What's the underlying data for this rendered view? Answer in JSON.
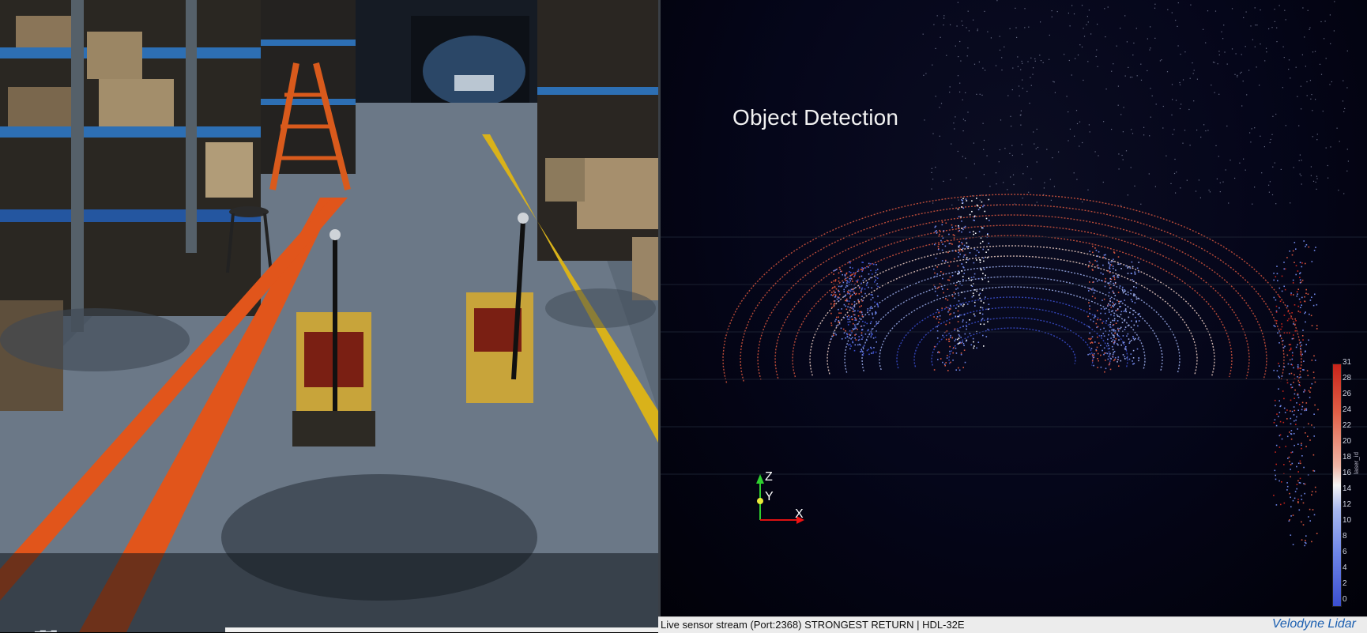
{
  "lidar_viewer": {
    "overlay_title": "Object Detection",
    "axes": {
      "z_label": "Z",
      "y_label": "Y",
      "x_label": "X"
    },
    "colorbar": {
      "field_label": "laser_id",
      "ticks": [
        "31",
        "28",
        "26",
        "24",
        "22",
        "20",
        "18",
        "16",
        "14",
        "12",
        "10",
        "8",
        "6",
        "4",
        "2",
        "0"
      ],
      "min": 0,
      "max": 31,
      "colors": {
        "high": "#c8231a",
        "mid": "#f5f5f5",
        "low": "#3b4fd0"
      }
    },
    "status_bar": {
      "stream_text": "Live sensor stream (Port:2368) STRONGEST RETURN  |  HDL-32E",
      "brand": "Velodyne Lidar"
    }
  },
  "camera_view": {
    "bottom_label": "▁▂▁▂"
  }
}
